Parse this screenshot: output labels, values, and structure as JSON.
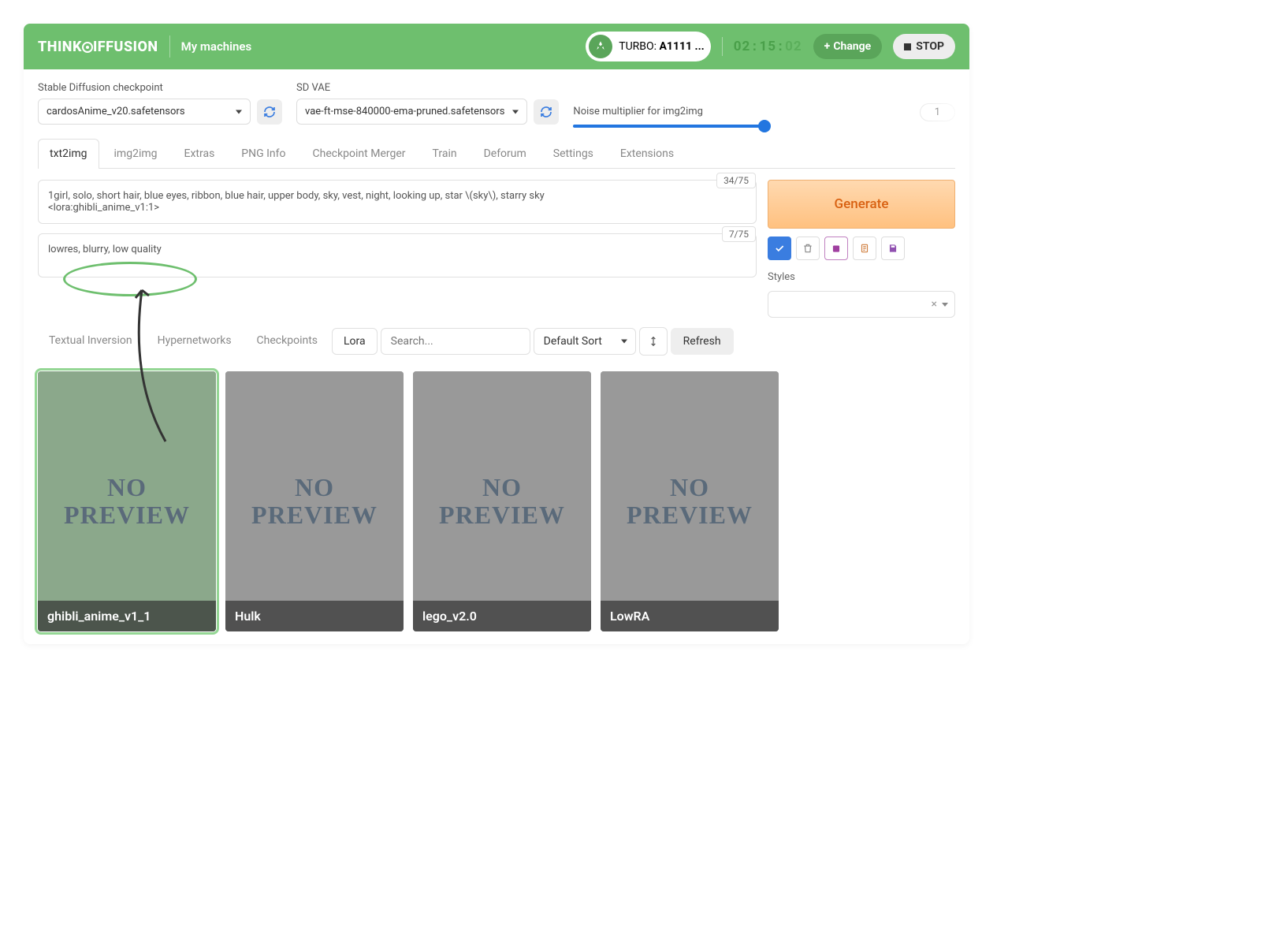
{
  "topbar": {
    "logo_think": "THINK",
    "logo_suffix": "IFFUSION",
    "my_machines": "My machines",
    "turbo_label": "TURBO: ",
    "turbo_value": "A1111 ...",
    "timer_h": "02",
    "timer_m": "15",
    "timer_s": "02",
    "change": "Change",
    "stop": "STOP"
  },
  "controls": {
    "checkpoint_label": "Stable Diffusion checkpoint",
    "checkpoint_value": "cardosAnime_v20.safetensors",
    "vae_label": "SD VAE",
    "vae_value": "vae-ft-mse-840000-ema-pruned.safetensors",
    "noise_label": "Noise multiplier for img2img",
    "noise_value": "1"
  },
  "tabs": [
    "txt2img",
    "img2img",
    "Extras",
    "PNG Info",
    "Checkpoint Merger",
    "Train",
    "Deforum",
    "Settings",
    "Extensions"
  ],
  "active_tab": 0,
  "prompt": {
    "positive": "1girl, solo, short hair, blue eyes, ribbon, blue hair, upper body, sky, vest, night, looking up, star \\(sky\\), starry sky\n<lora:ghibli_anime_v1:1>",
    "positive_count": "34/75",
    "negative": "lowres, blurry, low quality",
    "negative_count": "7/75"
  },
  "side": {
    "generate": "Generate",
    "styles_label": "Styles"
  },
  "subtabs": [
    "Textual Inversion",
    "Hypernetworks",
    "Checkpoints",
    "Lora"
  ],
  "active_subtab": 3,
  "search_placeholder": "Search...",
  "sort_label": "Default Sort",
  "refresh": "Refresh",
  "no_preview_text": "NO\nPREVIEW",
  "cards": [
    {
      "name": "ghibli_anime_v1_1",
      "selected": true
    },
    {
      "name": "Hulk",
      "selected": false
    },
    {
      "name": "lego_v2.0",
      "selected": false
    },
    {
      "name": "LowRA",
      "selected": false
    }
  ]
}
